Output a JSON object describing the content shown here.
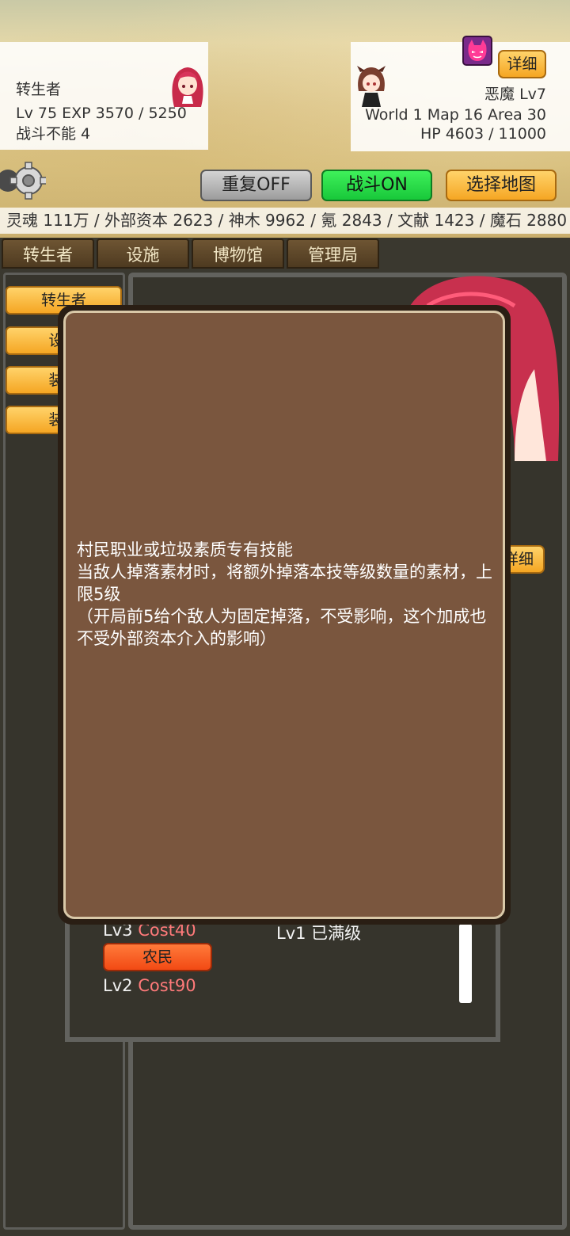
{
  "player": {
    "name": "转生者",
    "stats": "Lv 75 EXP 3570 / 5250",
    "status": "战斗不能 4"
  },
  "enemy": {
    "name": "恶魔 Lv7",
    "location": "World 1 Map 16 Area 30",
    "hp": "HP 4603 / 11000",
    "detail_label": "详细"
  },
  "controls": {
    "repeat_label": "重复OFF",
    "battle_label": "战斗ON",
    "map_label": "选择地图"
  },
  "resources": "灵魂 111万 / 外部资本 2623 / 神木 9962 / 氪 2843 / 文献 1423 / 魔石 2880",
  "tabs": [
    "转生者",
    "设施",
    "博物馆",
    "管理局"
  ],
  "side_buttons": [
    "转生者",
    "设置",
    "装备",
    "装备"
  ],
  "right_detail_label": "详细",
  "popup": {
    "description": "村民职业或垃圾素质专有技能\n当敌人掉落素材时，将额外掉落本技等级数量的素材，上限5级\n（开局前5给个敌人为固定掉落，不受影响，这个加成也不受外部资本介入的影响）"
  },
  "skills": {
    "row1_lv": "Lv3",
    "row1_cost": "Cost40",
    "row1_right": "Lv1 已满级",
    "farmer_label": "农民",
    "row2_lv": "Lv2",
    "row2_cost": "Cost90"
  }
}
